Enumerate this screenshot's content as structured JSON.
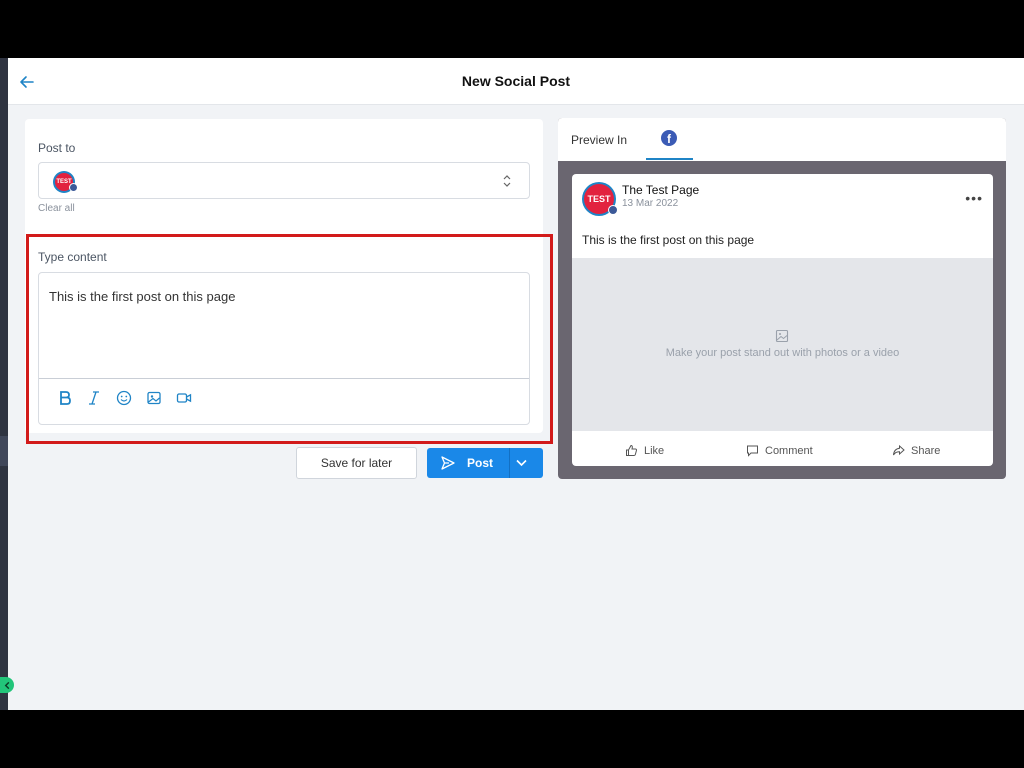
{
  "header": {
    "title": "New Social Post"
  },
  "compose": {
    "post_to_label": "Post to",
    "avatar_text": "TEST",
    "clear_all": "Clear all",
    "type_content_label": "Type content",
    "content": "This is the first post on this page"
  },
  "toolbar": {
    "bold_icon": "bold-icon",
    "italic_icon": "italic-icon",
    "emoji_icon": "emoji-icon",
    "image_icon": "image-icon",
    "video_icon": "video-icon"
  },
  "actions": {
    "save_label": "Save for later",
    "post_label": "Post"
  },
  "preview": {
    "label": "Preview In",
    "page_name": "The Test Page",
    "date": "13 Mar 2022",
    "post_text": "This is the first post on this page",
    "media_placeholder": "Make your post stand out with photos or a video",
    "like": "Like",
    "comment": "Comment",
    "share": "Share"
  },
  "colors": {
    "accent": "#1a88e8",
    "highlight": "#d21a1a",
    "facebook": "#3b5bb5",
    "preview_bg": "#6a6670"
  }
}
